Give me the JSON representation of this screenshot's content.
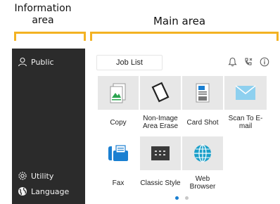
{
  "callouts": {
    "information_area": "Information\narea",
    "main_area": "Main area"
  },
  "sidebar": {
    "public": "Public",
    "utility": "Utility",
    "language": "Language"
  },
  "main": {
    "title": "Job List",
    "top_icons": [
      "bell-icon",
      "phone-icon",
      "info-icon"
    ],
    "tiles": [
      {
        "label": "Copy",
        "icon": "copy-icon"
      },
      {
        "label": "Non-Image Area Erase",
        "icon": "non-image-erase-icon"
      },
      {
        "label": "Card Shot",
        "icon": "card-shot-icon"
      },
      {
        "label": "Scan To E-mail",
        "icon": "envelope-icon"
      },
      {
        "label": "Fax",
        "icon": "fax-icon"
      },
      {
        "label": "Classic Style",
        "icon": "keypad-icon"
      },
      {
        "label": "Web Browser",
        "icon": "globe-icon"
      }
    ],
    "page_indicator": {
      "current": 1,
      "total": 2
    }
  },
  "colors": {
    "callout_bracket": "#f3b223",
    "sidebar_bg": "#2b2b2b",
    "tile_bg": "#e7e7e7",
    "accent_green": "#2aa44f",
    "accent_blue": "#1a7fd1",
    "envelope": "#8ed0ef"
  }
}
